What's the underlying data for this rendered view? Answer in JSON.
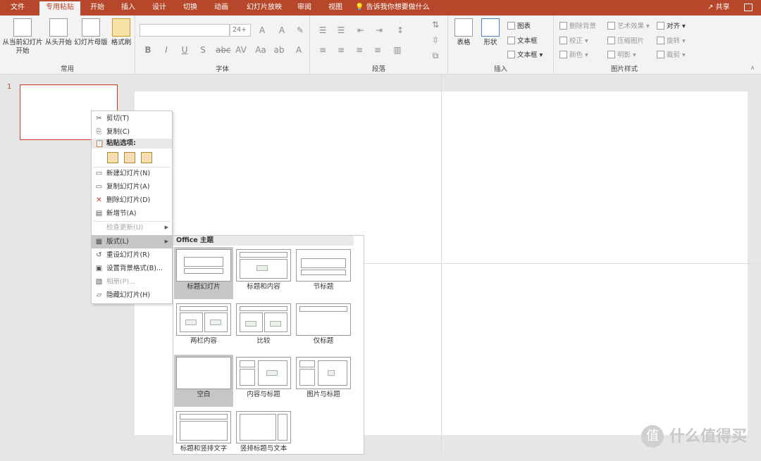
{
  "tabs": [
    "文件",
    "专用粘贴",
    "开始",
    "插入",
    "设计",
    "切换",
    "动画",
    "幻灯片放映",
    "审阅",
    "视图"
  ],
  "tell_me": "告诉我你想要做什么",
  "share": "共享",
  "ribbon": {
    "common": {
      "label": "常用",
      "btn1": "从当前幻灯片开始",
      "btn2": "从头开始",
      "btn3": "幻灯片母版",
      "btn4": "格式刷"
    },
    "font": {
      "label": "字体",
      "size": "24+"
    },
    "paragraph": {
      "label": "段落"
    },
    "insert": {
      "label": "插入",
      "table": "表格",
      "shape": "形状",
      "chart": "图表",
      "textbox1": "文本框",
      "textbox2": "文本框"
    },
    "picture": {
      "label": "图片样式",
      "remove_bg": "删除背景",
      "art": "艺术效果",
      "align": "对齐",
      "correct": "校正",
      "compress": "压缩图片",
      "rotate": "旋转",
      "color": "颜色",
      "reset": "明影",
      "crop": "裁剪"
    }
  },
  "slide_number": "1",
  "context_menu": {
    "cut": "剪切(T)",
    "copy": "复制(C)",
    "paste_options": "粘贴选项:",
    "new_slide": "新建幻灯片(N)",
    "dup_slide": "复制幻灯片(A)",
    "del_slide": "删除幻灯片(D)",
    "new_section": "新增节(A)",
    "check_update": "检查更新(U)",
    "layout": "版式(L)",
    "reset_slide": "重设幻灯片(R)",
    "format_bg": "设置背景格式(B)...",
    "album": "相册(P)...",
    "hide_slide": "隐藏幻灯片(H)"
  },
  "layout_menu": {
    "header": "Office 主题",
    "items": [
      "标题幻灯片",
      "标题和内容",
      "节标题",
      "两栏内容",
      "比较",
      "仅标题",
      "空白",
      "内容与标题",
      "图片与标题",
      "标题和竖排文字",
      "竖排标题与文本"
    ]
  },
  "watermark": "什么值得买"
}
